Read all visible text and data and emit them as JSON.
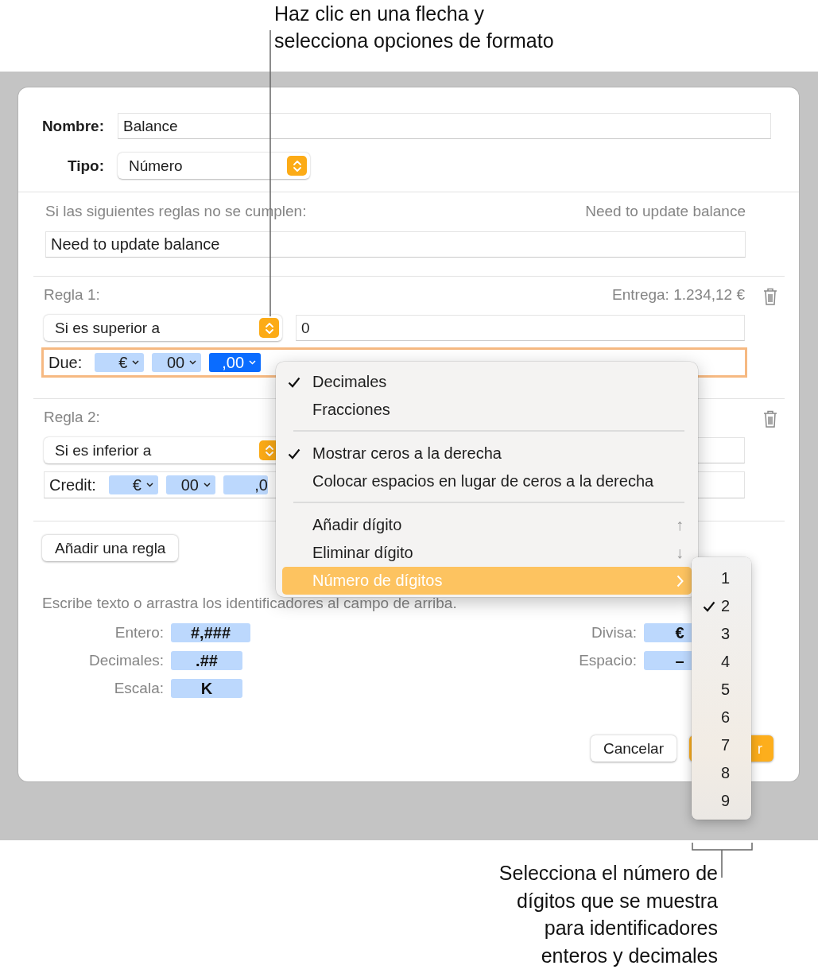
{
  "callouts": [
    {
      "kind": "top",
      "lines": [
        "Haz clic en una flecha y",
        "selecciona opciones de formato"
      ]
    },
    {
      "kind": "bottom",
      "lines": [
        "Selecciona el número de",
        "dígitos que se muestra",
        "para identificadores",
        "enteros y decimales"
      ]
    }
  ],
  "dialog": {
    "name": {
      "label": "Nombre:",
      "value": "Balance"
    },
    "type": {
      "label": "Tipo:",
      "value": "Número"
    },
    "message": {
      "label": "Si las siguientes reglas no se cumplen:",
      "preview": "Need to update balance",
      "value": "Need to update balance"
    },
    "rules": [
      {
        "label": "Regla 1:",
        "preview": "Entrega: 1.234,12 €",
        "condition": "Si es superior a",
        "value": "0",
        "format_label": "Due:",
        "focused": true,
        "tokens": [
          {
            "text": "€",
            "caret": true,
            "selected": false
          },
          {
            "text": "00",
            "caret": true,
            "selected": false
          },
          {
            "text": ",00",
            "caret": true,
            "selected": true
          }
        ]
      },
      {
        "label": "Regla 2:",
        "condition": "Si es inferior a",
        "format_label": "Credit:",
        "focused": false,
        "tokens": [
          {
            "text": "€",
            "caret": true,
            "selected": false
          },
          {
            "text": "00",
            "caret": true,
            "selected": false
          },
          {
            "text": ",0",
            "caret": false,
            "selected": false
          }
        ]
      }
    ],
    "add_rule_button": "Añadir una regla",
    "hint": "Escribe texto o arrastra los identificadores al campo de arriba.",
    "tokens_left": [
      {
        "label": "Entero:",
        "token": "#,###"
      },
      {
        "label": "Decimales:",
        "token": ".##"
      },
      {
        "label": "Escala:",
        "token": "K"
      }
    ],
    "tokens_right": [
      {
        "label": "Divisa:",
        "token": "€"
      },
      {
        "label": "Espacio:",
        "token": "–"
      }
    ],
    "buttons": [
      {
        "label": "Cancelar",
        "kind": "secondary"
      },
      {
        "label": "r",
        "kind": "primary"
      }
    ]
  },
  "menu": {
    "groups": [
      [
        {
          "label": "Decimales",
          "checked": true
        },
        {
          "label": "Fracciones",
          "checked": false
        }
      ],
      [
        {
          "label": "Mostrar ceros a la derecha",
          "checked": true
        },
        {
          "label": "Colocar espacios en lugar de ceros a la derecha",
          "checked": false
        }
      ],
      [
        {
          "label": "Añadir dígito",
          "shortcut": "↑",
          "selected": false
        },
        {
          "label": "Eliminar dígito",
          "shortcut": "↓",
          "selected": false
        },
        {
          "label": "Número de dígitos",
          "submenu": true,
          "selected": true
        }
      ]
    ]
  },
  "submenu": {
    "items": [
      {
        "label": "1",
        "checked": false
      },
      {
        "label": "2",
        "checked": true
      },
      {
        "label": "3",
        "checked": false
      },
      {
        "label": "4",
        "checked": false
      },
      {
        "label": "5",
        "checked": false
      },
      {
        "label": "6",
        "checked": false
      },
      {
        "label": "7",
        "checked": false
      },
      {
        "label": "8",
        "checked": false
      },
      {
        "label": "9",
        "checked": false
      }
    ]
  }
}
